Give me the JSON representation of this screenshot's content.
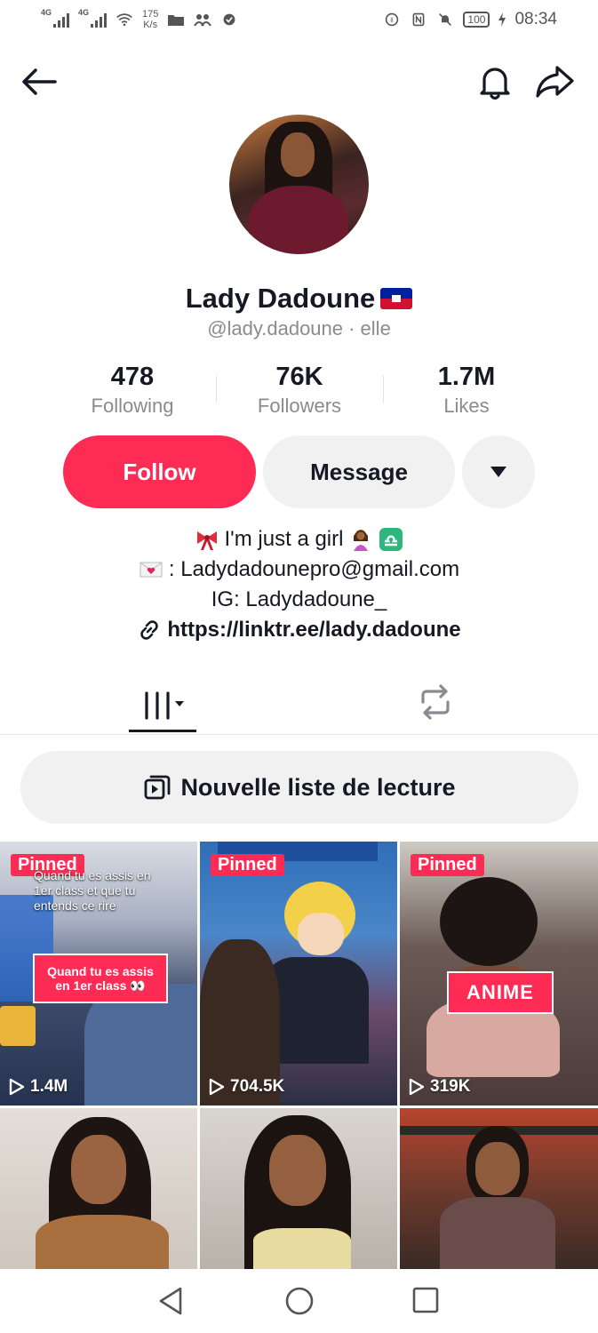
{
  "status_bar": {
    "signal1_label": "4G",
    "signal2_label": "4G",
    "speed_value": "175",
    "speed_unit": "K/s",
    "battery": "100",
    "time": "08:34"
  },
  "profile": {
    "name": "Lady Dadoune",
    "handle": "@lady.dadoune · elle",
    "stats": [
      {
        "value": "478",
        "label": "Following"
      },
      {
        "value": "76K",
        "label": "Followers"
      },
      {
        "value": "1.7M",
        "label": "Likes"
      }
    ]
  },
  "actions": {
    "follow_label": "Follow",
    "message_label": "Message"
  },
  "bio": {
    "line1": "I'm just a girl",
    "line2": ": Ladydadounepro@gmail.com",
    "line3": "IG: Ladydadoune_",
    "link": "https://linktr.ee/lady.dadoune"
  },
  "playlist": {
    "label": "Nouvelle liste de lecture"
  },
  "videos": [
    {
      "pinned": "Pinned",
      "views": "1.4M",
      "caption": "Quand tu es assis en 1er class et que tu entends ce rire",
      "sticker": "Quand tu es assis en 1er class 👀"
    },
    {
      "pinned": "Pinned",
      "views": "704.5K"
    },
    {
      "pinned": "Pinned",
      "views": "319K",
      "sticker": "ANIME"
    },
    {},
    {},
    {}
  ],
  "colors": {
    "accent": "#fe2c55",
    "text": "#161823",
    "muted": "#8a8b91",
    "button_bg": "#f1f1f2"
  },
  "icons": {
    "back": "arrow-left-icon",
    "bell": "bell-icon",
    "share": "share-icon",
    "more": "caret-down-icon",
    "videos_tab": "grid-bars-icon",
    "reposts_tab": "repost-icon",
    "playlist": "playlist-icon",
    "link": "link-icon",
    "play": "play-icon"
  }
}
